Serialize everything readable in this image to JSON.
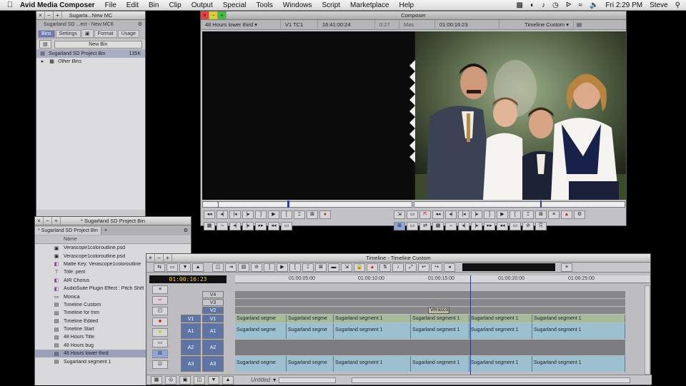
{
  "menubar": {
    "app_name": "Avid Media Composer",
    "items": [
      "File",
      "Edit",
      "Bin",
      "Clip",
      "Output",
      "Special",
      "Tools",
      "Windows",
      "Script",
      "Marketplace",
      "Help"
    ],
    "clock": "Fri 2:29 PM",
    "user": "Steve"
  },
  "bin1": {
    "title": "Sugarla...New MC",
    "tab": "Sugarland SD ...ect - New MC6",
    "subtabs": [
      "Bins",
      "Settings",
      "Format",
      "Usage"
    ],
    "new_bin_label": "New Bin",
    "items": [
      {
        "name": "Sugarland SD Project Bin",
        "size": "135K"
      },
      {
        "name": "Other Bins",
        "size": ""
      }
    ]
  },
  "bin2": {
    "title": "* Sugarland SD Project Bin",
    "tab": "* Sugarland SD Project Bin",
    "column": "Name",
    "items": [
      {
        "name": "Verascope1coloroutline.psd",
        "icon": "image-icon"
      },
      {
        "name": "Verascope1coloroutline.psd",
        "icon": "image-icon"
      },
      {
        "name": "Matte Key: Verascope1coloroutline",
        "icon": "effect-icon"
      },
      {
        "name": "Title: peril",
        "icon": "title-icon"
      },
      {
        "name": "AIR Chorus",
        "icon": "effect-icon"
      },
      {
        "name": "AudioSuite Plugin Effect : Pitch Shift",
        "icon": "effect-icon"
      },
      {
        "name": "Monica",
        "icon": "clip-icon"
      },
      {
        "name": "Timeline Custom",
        "icon": "sequence-icon"
      },
      {
        "name": "Timeline for trim",
        "icon": "sequence-icon"
      },
      {
        "name": "Timeline Edited",
        "icon": "sequence-icon"
      },
      {
        "name": "Timeline Start",
        "icon": "sequence-icon"
      },
      {
        "name": "48 Hours Title",
        "icon": "sequence-icon"
      },
      {
        "name": "48 Hours bug",
        "icon": "sequence-icon"
      },
      {
        "name": "48 Hours lower third",
        "icon": "sequence-icon"
      },
      {
        "name": "Sugarland segment 1",
        "icon": "sequence-icon"
      }
    ],
    "selected_index": 13
  },
  "composer": {
    "title": "Composer",
    "source_name": "48 Hours lower third",
    "track_selector": "V1  TC1",
    "source_tc": "16:41:00:24",
    "duration": "0:27",
    "mode": "Mas",
    "record_tc": "01:00:16:23",
    "record_name": "Timeline Custom"
  },
  "timeline": {
    "title": "Timeline - Timeline Custom",
    "timecode": "01:00:16:23",
    "ruler_labels": [
      "01:00:05:00",
      "01:00:10:00",
      "01:00:15:00",
      "01:00:20:00",
      "01:00:25:00"
    ],
    "tracks": [
      "V4",
      "V3",
      "V2",
      "V1",
      "A1",
      "A2",
      "A3"
    ],
    "source_tracks": [
      "V1",
      "A1",
      "A2",
      "A3"
    ],
    "clip_label": "Sugarland segme",
    "clip_label_full": "Sugarland segment 1",
    "v2_clip": "Verascope",
    "bottom_label": "Untitled"
  }
}
